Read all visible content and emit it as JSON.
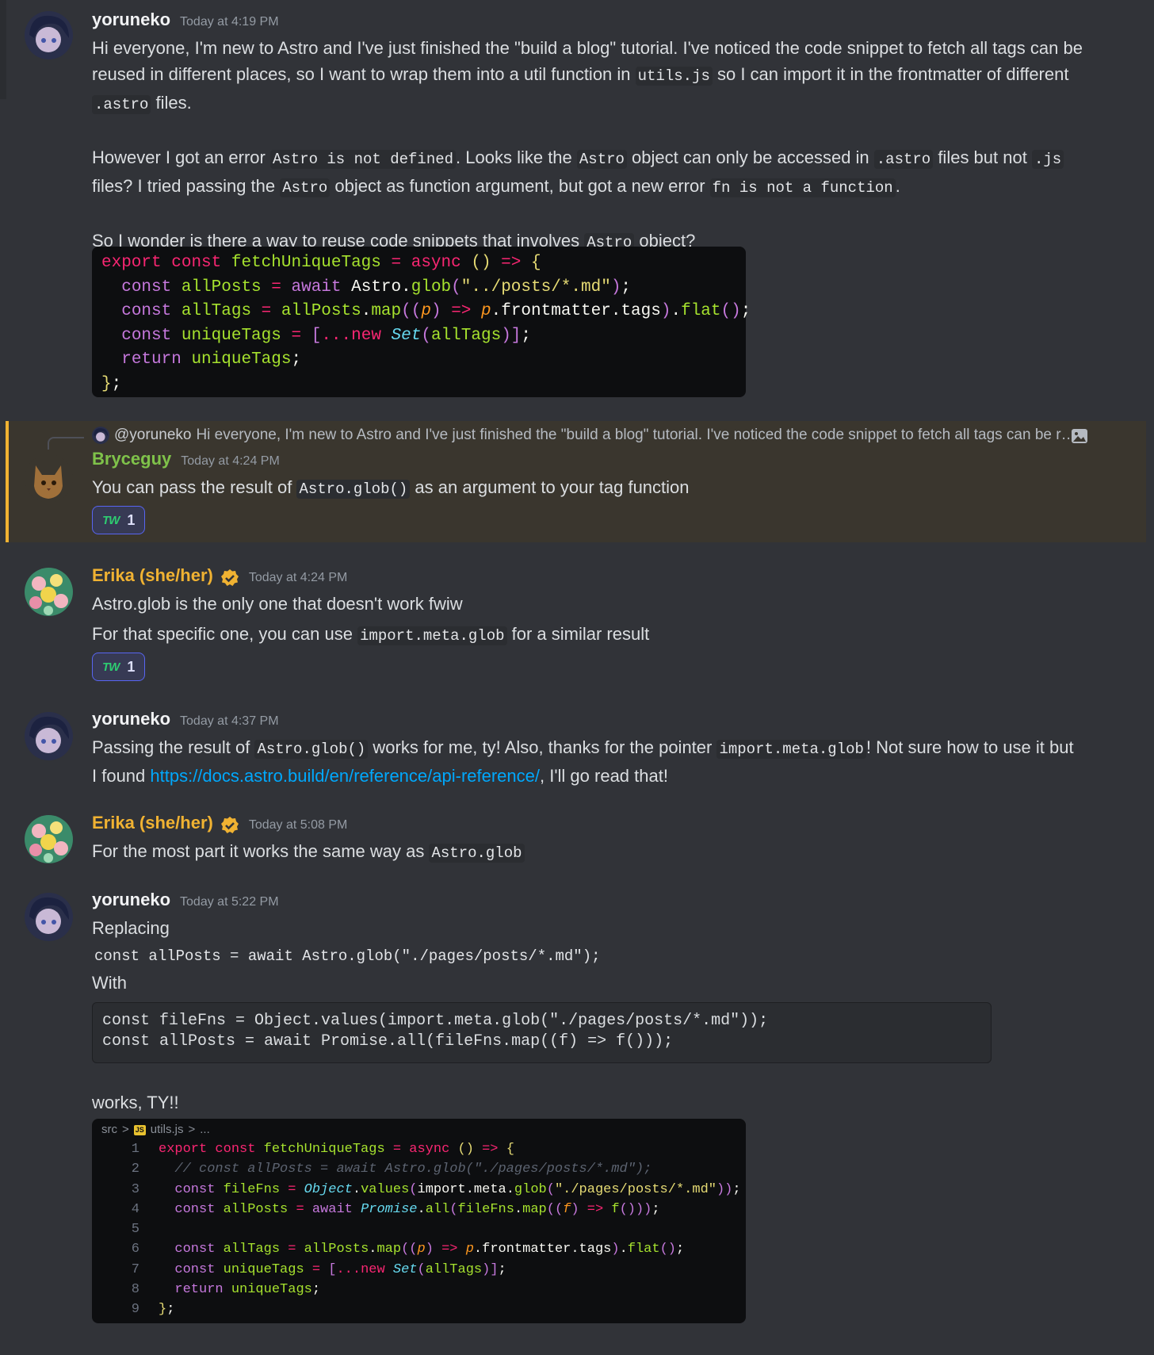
{
  "messages": {
    "m1": {
      "author": "yoruneko",
      "timestamp": "Today at 4:19 PM",
      "p1": [
        "Hi everyone, I'm new to Astro and I've just finished the \"build a blog\" tutorial. I've noticed the code snippet to fetch all tags can be reused in different places, so I want to wrap them into a util function in ",
        "utils.js",
        " so I can import it in the frontmatter of different ",
        ".astro",
        " files."
      ],
      "p2": [
        "However I got an error ",
        "Astro is not defined",
        ". Looks like the ",
        "Astro",
        " object can only be accessed in ",
        ".astro",
        " files but not ",
        ".js",
        " files? I tried passing the ",
        "Astro",
        " object as function argument, but got a new error ",
        "fn is not a function",
        "."
      ],
      "p3": [
        "So I wonder is there a way to reuse code snippets that involves ",
        "Astro",
        " object?"
      ],
      "code": [
        "export const fetchUniqueTags = async () => {",
        "  const allPosts = await Astro.glob(\"../posts/*.md\");",
        "  const allTags = allPosts.map((p) => p.frontmatter.tags).flat();",
        "  const uniqueTags = [...new Set(allTags)];",
        "  return uniqueTags;",
        "};"
      ]
    },
    "m2": {
      "reply_to_name": "@yoruneko",
      "reply_to_text": "Hi everyone, I'm new to Astro and I've just finished the \"build a blog\" tutorial. I've noticed the code snippet to fetch all tags can be reused in different places, so I want to wrap them into a util function",
      "author": "Bryceguy",
      "timestamp": "Today at 4:24 PM",
      "p1": [
        "You can pass the result of ",
        "Astro.glob()",
        " as an argument to your tag function"
      ],
      "reaction_emoji": "TW",
      "reaction_count": "1"
    },
    "m3": {
      "author": "Erika (she/her)",
      "timestamp": "Today at 4:24 PM",
      "p1": "Astro.glob is the only one that doesn't work fwiw",
      "p2": [
        "For that specific one, you can use ",
        "import.meta.glob",
        " for a similar result"
      ],
      "reaction_emoji": "TW",
      "reaction_count": "1"
    },
    "m4": {
      "author": "yoruneko",
      "timestamp": "Today at 4:37 PM",
      "p1": [
        "Passing the result of ",
        "Astro.glob()",
        " works for me, ty! Also, thanks for the pointer ",
        "import.meta.glob",
        "! Not sure how to use it but I found ",
        "https://docs.astro.build/en/reference/api-reference/",
        ", I'll go read that!"
      ]
    },
    "m5": {
      "author": "Erika (she/her)",
      "timestamp": "Today at 5:08 PM",
      "p1": [
        "For the most part it works the same way as ",
        "Astro.glob"
      ]
    },
    "m6": {
      "author": "yoruneko",
      "timestamp": "Today at 5:22 PM",
      "line1": "Replacing",
      "line2": "const allPosts = await Astro.glob(\"./pages/posts/*.md\");",
      "line3": "With",
      "block": [
        "const fileFns = Object.values(import.meta.glob(\"./pages/posts/*.md\"));",
        "const allPosts = await Promise.all(fileFns.map((f) => f()));"
      ],
      "line4": "works, TY!!",
      "crumb": [
        "src",
        ">",
        "JS",
        "utils.js",
        ">",
        "..."
      ],
      "code": [
        "export const fetchUniqueTags = async () => {",
        "  // const allPosts = await Astro.glob(\"./pages/posts/*.md\");",
        "  const fileFns = Object.values(import.meta.glob(\"./pages/posts/*.md\"));",
        "  const allPosts = await Promise.all(fileFns.map((f) => f()));",
        "",
        "  const allTags = allPosts.map((p) => p.frontmatter.tags).flat();",
        "  const uniqueTags = [...new Set(allTags)];",
        "  return uniqueTags;",
        "};"
      ],
      "line_numbers": [
        "1",
        "2",
        "3",
        "4",
        "5",
        "6",
        "7",
        "8",
        "9"
      ]
    }
  },
  "colors": {
    "background": "#313338",
    "mention_highlight": "#3a362e",
    "mention_bar": "#f0b232",
    "link": "#00a8fc",
    "green_name": "#7fc24a",
    "gold_name": "#f0b232"
  }
}
